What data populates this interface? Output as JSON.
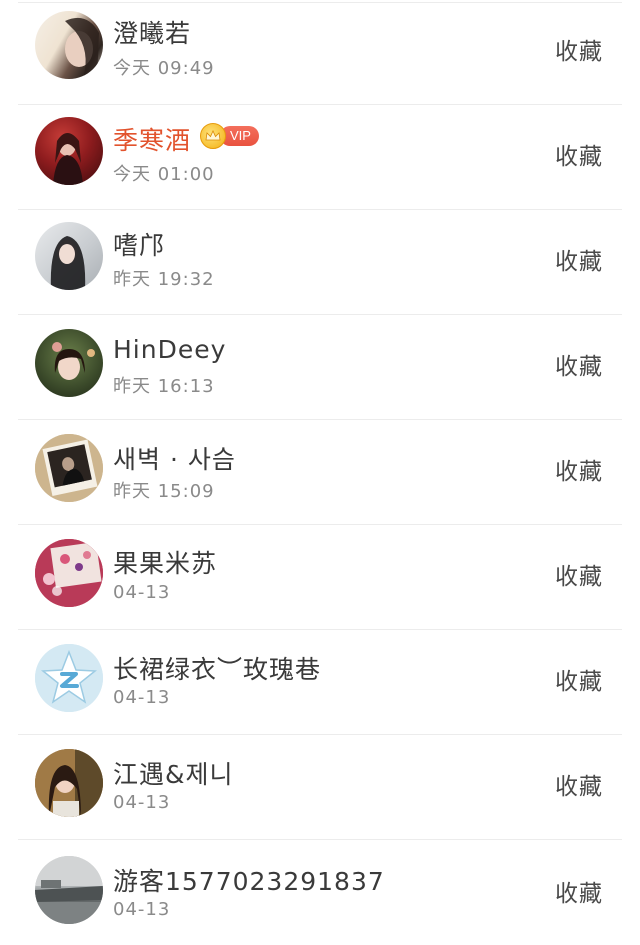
{
  "rows": [
    {
      "name": "澄曦若",
      "time": "今天 09:49",
      "action": "收藏",
      "vip": false,
      "avatar": "woman-photo-avatar"
    },
    {
      "name": "季寒酒",
      "time": "今天 01:00",
      "action": "收藏",
      "vip": true,
      "vip_label": "VIP",
      "avatar": "dark-red-photo-avatar"
    },
    {
      "name": "嗜邝",
      "time": "昨天 19:32",
      "action": "收藏",
      "vip": false,
      "avatar": "girl-photo-avatar"
    },
    {
      "name": "HinDeey",
      "time": "昨天 16:13",
      "action": "收藏",
      "vip": false,
      "avatar": "girl-photo-avatar"
    },
    {
      "name": "새벽 · 사슴",
      "time": "昨天 15:09",
      "action": "收藏",
      "vip": false,
      "avatar": "photo-frame-avatar"
    },
    {
      "name": "果果米苏",
      "time": "04-13",
      "action": "收藏",
      "vip": false,
      "avatar": "floral-photo-avatar"
    },
    {
      "name": "长裙绿衣︶玫瑰巷",
      "time": "04-13",
      "action": "收藏",
      "vip": false,
      "avatar": "star-logo-avatar"
    },
    {
      "name": "江遇&제니",
      "time": "04-13",
      "action": "收藏",
      "vip": false,
      "avatar": "girl-photo-avatar"
    },
    {
      "name": "游客1577023291837",
      "time": "04-13",
      "action": "收藏",
      "vip": false,
      "avatar": "landscape-photo-avatar"
    }
  ],
  "colors": {
    "vip_name": "#e2532d",
    "name": "#3a3a3a",
    "time": "#8a8a8a",
    "action": "#4a4a4a",
    "divider": "#ececec"
  }
}
